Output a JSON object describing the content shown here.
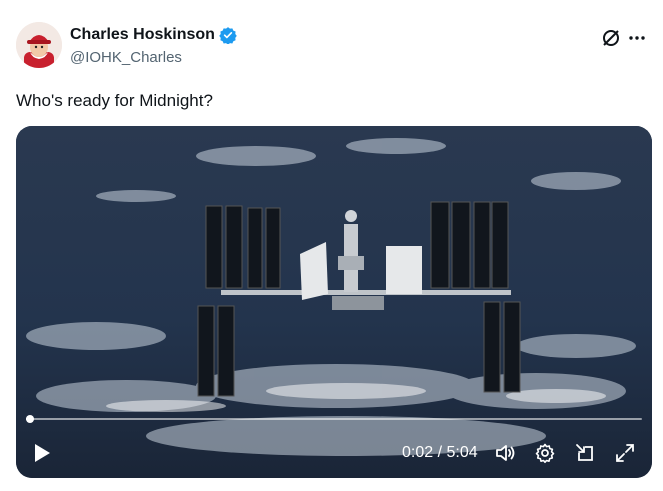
{
  "author": {
    "display_name": "Charles Hoskinson",
    "handle": "@IOHK_Charles",
    "verified": true,
    "avatar_icon": "avatar-cartoon-red-hat"
  },
  "header_actions": {
    "grok_icon": "grok-icon",
    "more_icon": "more-icon"
  },
  "tweet": {
    "text": "Who's ready for Midnight?"
  },
  "video": {
    "time_display": "0:02 / 5:04",
    "progress_fraction": 0.007,
    "controls": [
      "play-icon",
      "volume-icon",
      "settings-icon",
      "picture-in-picture-icon",
      "fullscreen-icon"
    ]
  },
  "colors": {
    "accent": "#1d9bf0",
    "text": "#0f1419",
    "secondary_text": "#536471"
  }
}
